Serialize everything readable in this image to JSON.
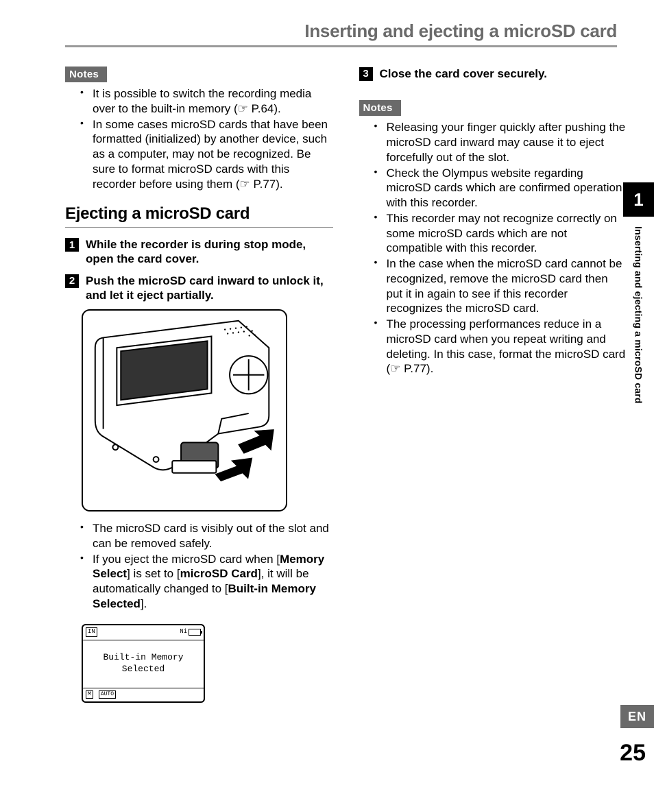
{
  "header": {
    "title": "Inserting and ejecting a microSD card"
  },
  "sidebar": {
    "chapter": "1",
    "caption": "Inserting and ejecting a microSD card",
    "lang": "EN",
    "page": "25"
  },
  "left": {
    "notes_label": "Notes",
    "notes": [
      "It is possible to switch the recording media over to the built-in memory (☞ P.64).",
      "In some cases microSD cards that have been formatted (initialized) by another device, such as a computer, may not be recognized. Be sure to format microSD cards with this recorder before using them (☞ P.77)."
    ],
    "subheading": "Ejecting a microSD card",
    "steps": [
      {
        "num": "1",
        "text": "While the recorder is during stop mode, open the card cover."
      },
      {
        "num": "2",
        "text": "Push the microSD card inward to unlock it, and let it eject partially."
      }
    ],
    "after_fig_bullets": [
      {
        "text": "The microSD card is visibly out of the slot and can be removed safely."
      },
      {
        "prefix": "If you eject the microSD card when [",
        "b1": "Memory Select",
        "mid1": "] is set to [",
        "b2": "microSD Card",
        "mid2": "], it will be automatically changed to [",
        "b3": "Built-in Memory Selected",
        "suffix": "]."
      }
    ],
    "screen": {
      "top_left": "IN",
      "top_right_label": "Ni",
      "line1": "Built-in Memory",
      "line2": "Selected",
      "bottom_left": "M",
      "bottom_badge": "AUTO"
    }
  },
  "right": {
    "step": {
      "num": "3",
      "text": "Close the card cover securely."
    },
    "notes_label": "Notes",
    "notes": [
      "Releasing your finger quickly after pushing the microSD card inward may cause it to eject forcefully out of the slot.",
      "Check the Olympus website regarding microSD cards which are confirmed operation with this recorder.",
      "This recorder may not recognize correctly on some microSD cards which are not compatible with this recorder.",
      "In the case when the microSD card cannot be recognized, remove the microSD card then put it in again to see if this recorder recognizes the microSD card.",
      "The processing performances reduce in a microSD card when you repeat writing and deleting. In this case, format the microSD card (☞ P.77)."
    ]
  }
}
